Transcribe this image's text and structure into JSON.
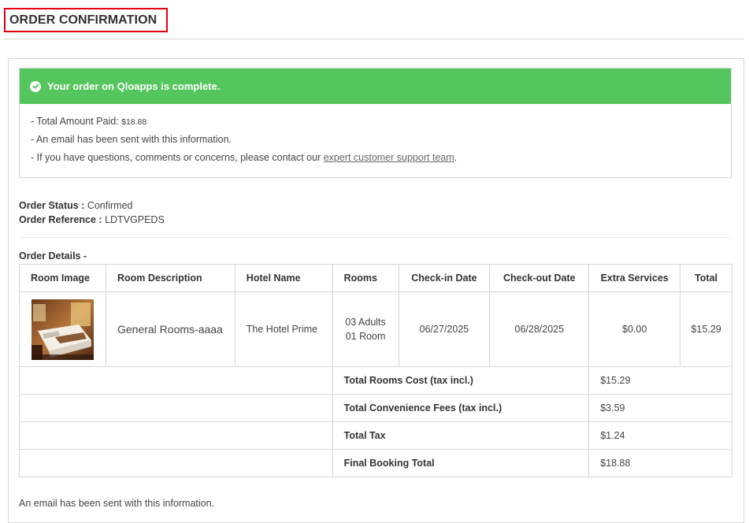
{
  "page": {
    "title": "ORDER CONFIRMATION"
  },
  "alert": {
    "message": "Your order on Qloapps is complete.",
    "lines": {
      "paid_prefix": "- Total Amount Paid: ",
      "paid_amount": "$18.88",
      "email": "- An email has been sent with this information.",
      "questions_prefix": "- If you have questions, comments or concerns, please contact our ",
      "support_link": "expert customer support team",
      "questions_suffix": "."
    }
  },
  "order": {
    "status_label": "Order Status :",
    "status_value": " Confirmed",
    "reference_label": "Order Reference :",
    "reference_value": " LDTVGPEDS",
    "details_label": "Order Details -"
  },
  "table": {
    "headers": {
      "image": "Room Image",
      "description": "Room Description",
      "hotel": "Hotel Name",
      "rooms": "Rooms",
      "checkin": "Check-in Date",
      "checkout": "Check-out Date",
      "extra": "Extra Services",
      "total": "Total"
    },
    "item": {
      "description": "General Rooms-aaaa",
      "hotel": "The Hotel Prime",
      "adults": "03 Adults",
      "room_count": "01 Room",
      "checkin": "06/27/2025",
      "checkout": "06/28/2025",
      "extra": "$0.00",
      "total": "$15.29"
    },
    "summary": [
      {
        "label": "Total Rooms Cost (tax incl.)",
        "value": "$15.29"
      },
      {
        "label": "Total Convenience Fees (tax incl.)",
        "value": "$3.59"
      },
      {
        "label": "Total Tax",
        "value": "$1.24"
      },
      {
        "label": "Final Booking Total",
        "value": "$18.88"
      }
    ]
  },
  "footer": {
    "note": "An email has been sent with this information."
  },
  "colors": {
    "success": "#55c65e",
    "highlight_border": "#e3000f"
  },
  "icons": {
    "alert": "check-circle-icon",
    "room": "room-photo"
  }
}
